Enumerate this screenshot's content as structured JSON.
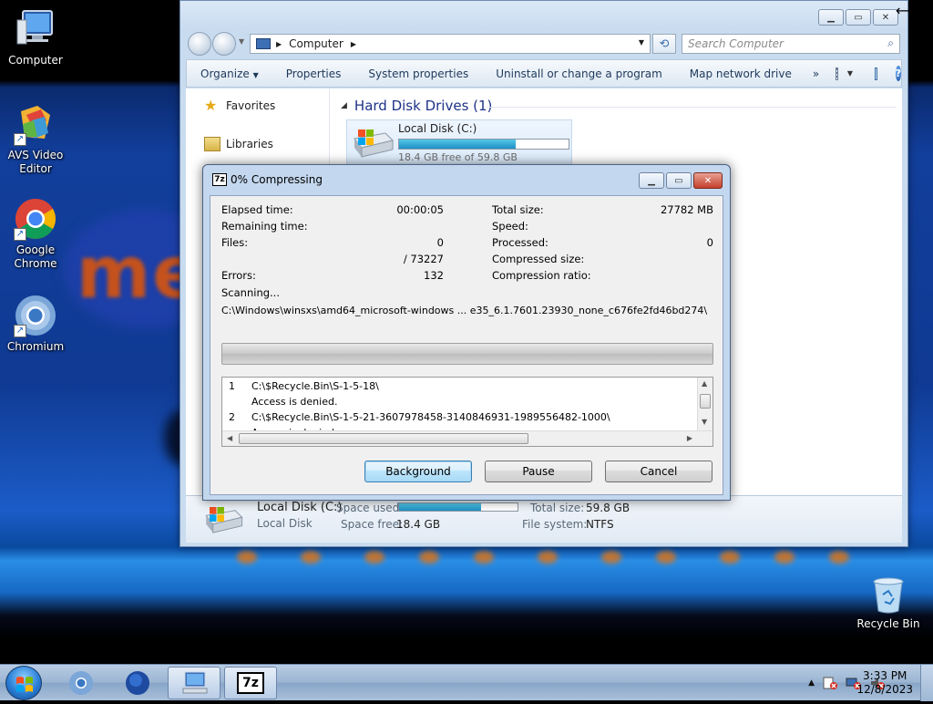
{
  "desktop": {
    "wallpaper_text": "me",
    "icons": [
      {
        "label": "Computer",
        "icon": "computer-icon"
      },
      {
        "label": "AVS Video Editor",
        "icon": "avs-video-editor-icon"
      },
      {
        "label": "Google Chrome",
        "icon": "chrome-icon"
      },
      {
        "label": "Chromium",
        "icon": "chromium-icon"
      },
      {
        "label": "Recycle Bin",
        "icon": "recycle-bin-icon"
      }
    ]
  },
  "explorer": {
    "address": {
      "location": "Computer"
    },
    "search": {
      "placeholder": "Search Computer"
    },
    "toolbar": {
      "organize": "Organize",
      "properties": "Properties",
      "system_properties": "System properties",
      "uninstall": "Uninstall or change a program",
      "map_drive": "Map network drive",
      "more": "»"
    },
    "nav": {
      "favorites": "Favorites",
      "libraries": "Libraries"
    },
    "group_header": "Hard Disk Drives (1)",
    "drive": {
      "name": "Local Disk (C:)",
      "free_text": "18.4 GB free of 59.8 GB",
      "used_fraction": 0.69
    },
    "details": {
      "name": "Local Disk (C:)",
      "type": "Local Disk",
      "space_used_label": "Space used:",
      "space_free_label": "Space free:",
      "space_free": "18.4 GB",
      "total_size_label": "Total size:",
      "total_size": "59.8 GB",
      "file_system_label": "File system:",
      "file_system": "NTFS"
    }
  },
  "dialog": {
    "app_badge": "7z",
    "title": "0% Compressing",
    "stats_left": {
      "elapsed_label": "Elapsed time:",
      "elapsed": "00:00:05",
      "remaining_label": "Remaining time:",
      "remaining": "",
      "files_label": "Files:",
      "files": "0",
      "files_total": "/ 73227",
      "errors_label": "Errors:",
      "errors": "132"
    },
    "stats_right": {
      "total_size_label": "Total size:",
      "total_size": "27782 MB",
      "speed_label": "Speed:",
      "speed": "",
      "processed_label": "Processed:",
      "processed": "0",
      "compressed_size_label": "Compressed size:",
      "compressed_size": "",
      "ratio_label": "Compression ratio:",
      "ratio": ""
    },
    "status": "Scanning...",
    "current_path": "C:\\Windows\\winsxs\\amd64_microsoft-windows ... e35_6.1.7601.23930_none_c676fe2fd46bd274\\",
    "progress_fraction": 0.0,
    "log": [
      {
        "num": "1",
        "text": "C:\\$Recycle.Bin\\S-1-5-18\\"
      },
      {
        "num": "",
        "text": "Access is denied."
      },
      {
        "num": "2",
        "text": "C:\\$Recycle.Bin\\S-1-5-21-3607978458-3140846931-1989556482-1000\\"
      },
      {
        "num": "",
        "text": "Access is denied."
      }
    ],
    "buttons": {
      "background": "Background",
      "pause": "Pause",
      "cancel": "Cancel"
    }
  },
  "taskbar": {
    "apps": [
      "chromium-icon",
      "firefox-icon",
      "explorer-icon",
      "7zip-icon"
    ],
    "app_badge": "7z",
    "clock": {
      "time": "3:33 PM",
      "date": "12/8/2023"
    }
  }
}
